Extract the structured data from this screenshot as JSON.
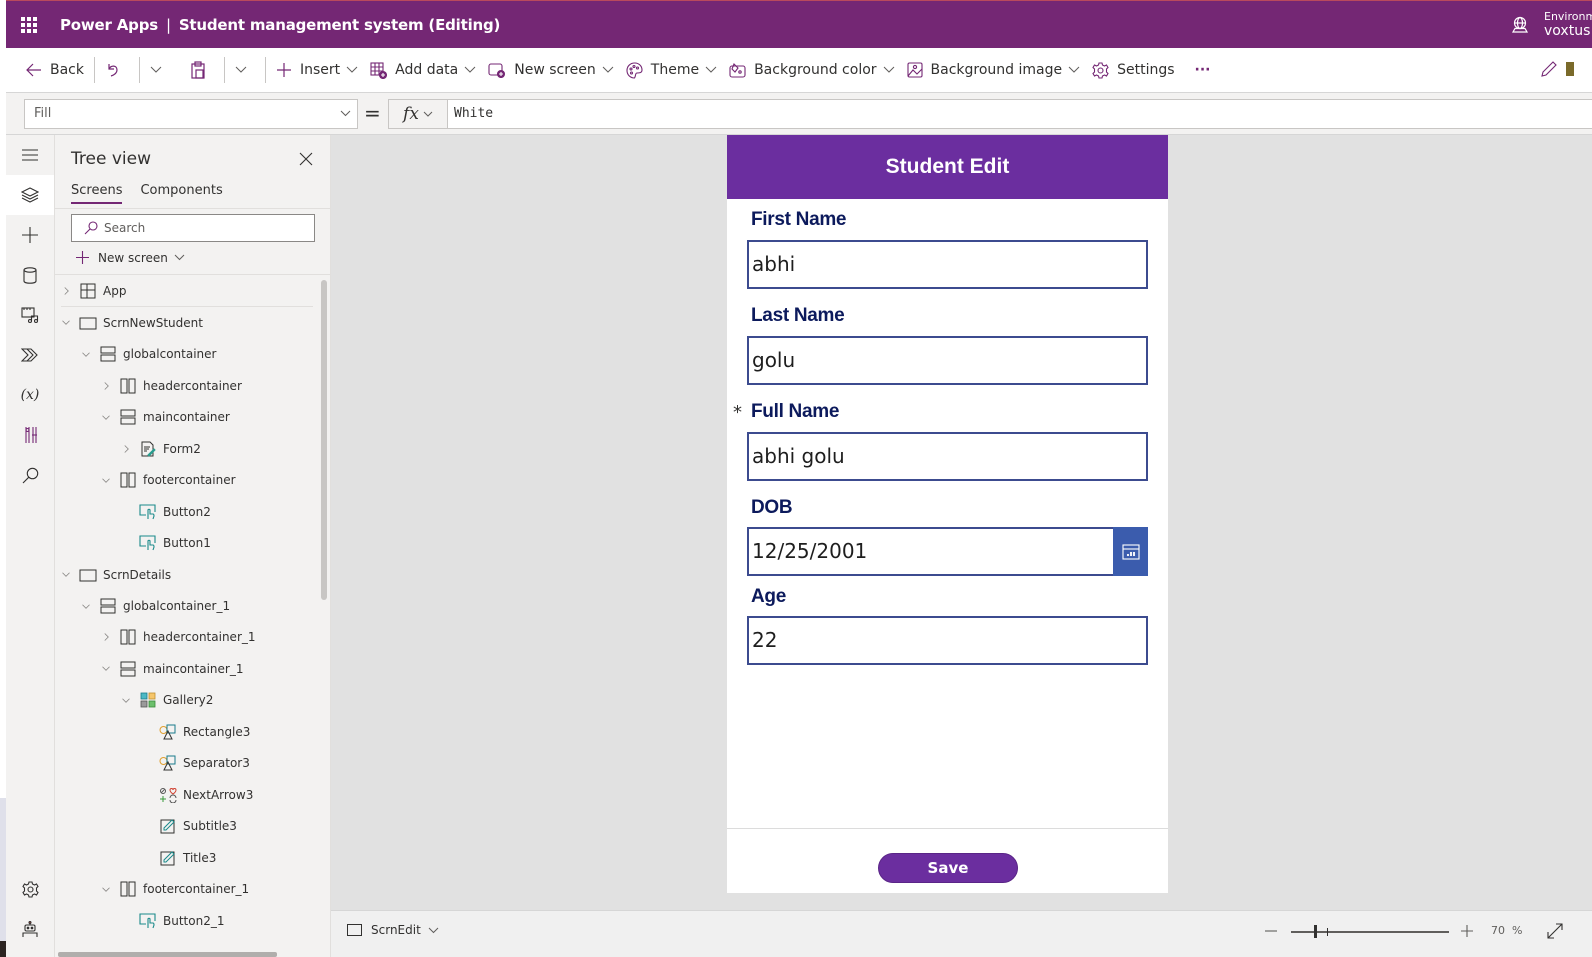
{
  "titlebar": {
    "product": "Power Apps",
    "separator": "|",
    "app_name": "Student management system (Editing)",
    "environment_label": "Environment",
    "environment_name": "voxtus"
  },
  "commandbar": {
    "back": "Back",
    "insert": "Insert",
    "add_data": "Add data",
    "new_screen": "New screen",
    "theme": "Theme",
    "background_color": "Background color",
    "background_image": "Background image",
    "settings": "Settings",
    "more": "···"
  },
  "formulabar": {
    "property": "Fill",
    "equals": "=",
    "fx": "fx",
    "formula": "White"
  },
  "treeview": {
    "title": "Tree view",
    "tabs": [
      {
        "label": "Screens",
        "active": true
      },
      {
        "label": "Components",
        "active": false
      }
    ],
    "search_placeholder": "Search",
    "new_screen": "New screen",
    "items": [
      {
        "label": "App",
        "type": "app",
        "depth": 0,
        "expander": "collapsed"
      },
      {
        "label": "ScrnNewStudent",
        "type": "screen",
        "depth": 0,
        "expander": "expanded"
      },
      {
        "label": "globalcontainer",
        "type": "vcontainer",
        "depth": 1,
        "expander": "expanded"
      },
      {
        "label": "headercontainer",
        "type": "hcontainer",
        "depth": 2,
        "expander": "collapsed"
      },
      {
        "label": "maincontainer",
        "type": "vcontainer",
        "depth": 2,
        "expander": "expanded"
      },
      {
        "label": "Form2",
        "type": "form",
        "depth": 3,
        "expander": "collapsed"
      },
      {
        "label": "footercontainer",
        "type": "hcontainer",
        "depth": 2,
        "expander": "expanded"
      },
      {
        "label": "Button2",
        "type": "button",
        "depth": 3,
        "expander": "none"
      },
      {
        "label": "Button1",
        "type": "button",
        "depth": 3,
        "expander": "none"
      },
      {
        "label": "ScrnDetails",
        "type": "screen",
        "depth": 0,
        "expander": "expanded"
      },
      {
        "label": "globalcontainer_1",
        "type": "vcontainer",
        "depth": 1,
        "expander": "expanded"
      },
      {
        "label": "headercontainer_1",
        "type": "hcontainer",
        "depth": 2,
        "expander": "collapsed"
      },
      {
        "label": "maincontainer_1",
        "type": "vcontainer",
        "depth": 2,
        "expander": "expanded"
      },
      {
        "label": "Gallery2",
        "type": "gallery",
        "depth": 3,
        "expander": "expanded"
      },
      {
        "label": "Rectangle3",
        "type": "shape",
        "depth": 4,
        "expander": "none"
      },
      {
        "label": "Separator3",
        "type": "shape",
        "depth": 4,
        "expander": "none"
      },
      {
        "label": "NextArrow3",
        "type": "icon",
        "depth": 4,
        "expander": "none"
      },
      {
        "label": "Subtitle3",
        "type": "label",
        "depth": 4,
        "expander": "none"
      },
      {
        "label": "Title3",
        "type": "label",
        "depth": 4,
        "expander": "none"
      },
      {
        "label": "footercontainer_1",
        "type": "hcontainer",
        "depth": 2,
        "expander": "expanded"
      },
      {
        "label": "Button2_1",
        "type": "button",
        "depth": 3,
        "expander": "none"
      }
    ]
  },
  "rail": {
    "items": [
      "menu-icon",
      "tree-view-icon",
      "insert-icon",
      "data-icon",
      "media-icon",
      "power-automate-icon",
      "variables-icon",
      "advanced-tools-icon",
      "search-icon"
    ],
    "bottom_items": [
      "settings-icon",
      "virtual-agent-icon"
    ]
  },
  "canvas": {
    "header_title": "Student Edit",
    "fields": [
      {
        "label": "First Name",
        "value": "abhi",
        "required": false
      },
      {
        "label": "Last Name",
        "value": "golu",
        "required": false
      },
      {
        "label": "Full Name",
        "value": "abhi golu",
        "required": true
      },
      {
        "label": "DOB",
        "value": "12/25/2001",
        "required": false,
        "type": "date"
      },
      {
        "label": "Age",
        "value": "22",
        "required": false
      }
    ],
    "required_marker": "*",
    "save_label": "Save"
  },
  "statusbar": {
    "screen_name": "ScrnEdit",
    "zoom_value": "70",
    "zoom_unit": "%",
    "zoom_percent": 70
  },
  "colors": {
    "titlebar": "#742774",
    "app_header": "#6b2e9f",
    "field_label": "#0c1a5c",
    "input_border": "#3c4b8f",
    "date_button": "#3b5cad"
  }
}
